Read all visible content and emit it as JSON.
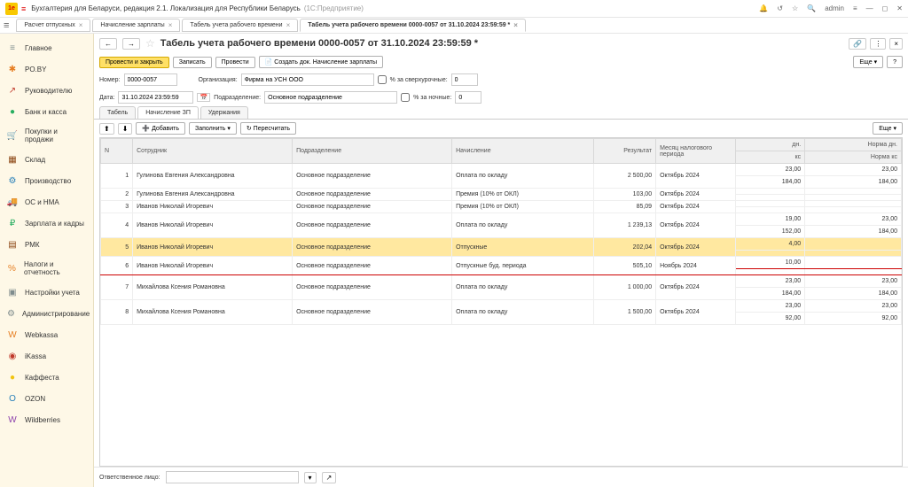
{
  "app": {
    "logo_text": "1e",
    "title": "Бухгалтерия для Беларуси, редакция 2.1. Локализация для Республики Беларусь",
    "subtitle": "(1С:Предприятие)",
    "user": "admin"
  },
  "tabs": [
    {
      "label": "Расчет отпускных"
    },
    {
      "label": "Начисление зарплаты"
    },
    {
      "label": "Табель учета рабочего времени"
    },
    {
      "label": "Табель учета рабочего времени 0000-0057 от 31.10.2024 23:59:59 *",
      "active": true
    }
  ],
  "sidebar": {
    "items": [
      {
        "label": "Главное",
        "icon": "≡",
        "cls": "c-gray"
      },
      {
        "label": "PO.BY",
        "icon": "✱",
        "cls": "c-orange"
      },
      {
        "label": "Руководителю",
        "icon": "↗",
        "cls": "c-red"
      },
      {
        "label": "Банк и касса",
        "icon": "●",
        "cls": "c-green"
      },
      {
        "label": "Покупки и продажи",
        "icon": "🛒",
        "cls": "c-brown"
      },
      {
        "label": "Склад",
        "icon": "▦",
        "cls": "c-brown"
      },
      {
        "label": "Производство",
        "icon": "⚙",
        "cls": "c-blue"
      },
      {
        "label": "ОС и НМА",
        "icon": "🚚",
        "cls": "c-brown"
      },
      {
        "label": "Зарплата и кадры",
        "icon": "₽",
        "cls": "c-green"
      },
      {
        "label": "РМК",
        "icon": "▤",
        "cls": "c-brown"
      },
      {
        "label": "Налоги и отчетность",
        "icon": "%",
        "cls": "c-orange"
      },
      {
        "label": "Настройки учета",
        "icon": "▣",
        "cls": "c-gray"
      },
      {
        "label": "Администрирование",
        "icon": "⚙",
        "cls": "c-gray"
      },
      {
        "label": "Webkassa",
        "icon": "W",
        "cls": "c-orange"
      },
      {
        "label": "iKassa",
        "icon": "◉",
        "cls": "c-red"
      },
      {
        "label": "Каффеста",
        "icon": "●",
        "cls": "c-yellow"
      },
      {
        "label": "OZON",
        "icon": "O",
        "cls": "c-blue"
      },
      {
        "label": "Wildberries",
        "icon": "W",
        "cls": "c-purple"
      }
    ]
  },
  "doc": {
    "title": "Табель учета рабочего времени 0000-0057 от 31.10.2024 23:59:59 *",
    "number_label": "Номер:",
    "number": "0000-0057",
    "org_label": "Организация:",
    "org": "Фирма на УСН ООО",
    "date_label": "Дата:",
    "date": "31.10.2024 23:59:59",
    "dept_label": "Подразделение:",
    "dept": "Основное подразделение",
    "overtime_label": "% за сверхурочные:",
    "overtime": "0",
    "night_label": "% за ночные:",
    "night": "0"
  },
  "toolbar": {
    "post_close": "Провести и закрыть",
    "save": "Записать",
    "post": "Провести",
    "create": "Создать док. Начисление зарплаты",
    "more": "Еще",
    "help": "?"
  },
  "subtabs": {
    "t1": "Табель",
    "t2": "Начисление ЗП",
    "t3": "Удержания"
  },
  "grid_toolbar": {
    "add": "Добавить",
    "fill": "Заполнить",
    "recalc": "Пересчитать",
    "more": "Еще"
  },
  "grid": {
    "headers": {
      "n": "N",
      "emp": "Сотрудник",
      "dept": "Подразделение",
      "accr": "Начисление",
      "res": "Результат",
      "period": "Месяц налогового периода",
      "dn": "дн.",
      "kc": "кс",
      "nd": "Норма дн.",
      "nk": "Норма кс"
    },
    "rows": [
      {
        "n": 1,
        "emp": "Гулинова Евгения Александровна",
        "dept": "Основное подразделение",
        "accr": "Оплата по окладу",
        "res": "2 500,00",
        "period": "Октябрь 2024",
        "dn": "23,00",
        "kc": "184,00",
        "nd": "23,00",
        "nk": "184,00"
      },
      {
        "n": 2,
        "emp": "Гулинова Евгения Александровна",
        "dept": "Основное подразделение",
        "accr": "Премия (10% от ОКЛ)",
        "res": "103,00",
        "period": "Октябрь 2024",
        "dn": "",
        "kc": "",
        "nd": "",
        "nk": ""
      },
      {
        "n": 3,
        "emp": "Иванов Николай Игоревич",
        "dept": "Основное подразделение",
        "accr": "Премия (10% от ОКЛ)",
        "res": "85,09",
        "period": "Октябрь 2024",
        "dn": "",
        "kc": "",
        "nd": "",
        "nk": ""
      },
      {
        "n": 4,
        "emp": "Иванов Николай Игоревич",
        "dept": "Основное подразделение",
        "accr": "Оплата по окладу",
        "res": "1 239,13",
        "period": "Октябрь 2024",
        "dn": "19,00",
        "kc": "152,00",
        "nd": "23,00",
        "nk": "184,00"
      },
      {
        "n": 5,
        "emp": "Иванов Николай Игоревич",
        "dept": "Основное подразделение",
        "accr": "Отпускные",
        "res": "202,04",
        "period": "Октябрь 2024",
        "dn": "4,00",
        "kc": "",
        "nd": "",
        "nk": "",
        "sel": true,
        "hlstart": true
      },
      {
        "n": 6,
        "emp": "Иванов Николай Игоревич",
        "dept": "Основное подразделение",
        "accr": "Отпускные буд. периода",
        "res": "505,10",
        "period": "Ноябрь 2024",
        "dn": "10,00",
        "kc": "",
        "nd": "",
        "nk": "",
        "hlend": true
      },
      {
        "n": 7,
        "emp": "Михайлова Ксения Романовна",
        "dept": "Основное подразделение",
        "accr": "Оплата по окладу",
        "res": "1 000,00",
        "period": "Октябрь 2024",
        "dn": "23,00",
        "kc": "184,00",
        "nd": "23,00",
        "nk": "184,00"
      },
      {
        "n": 8,
        "emp": "Михайлова Ксения Романовна",
        "dept": "Основное подразделение",
        "accr": "Оплата по окладу",
        "res": "1 500,00",
        "period": "Октябрь 2024",
        "dn": "23,00",
        "kc": "92,00",
        "nd": "23,00",
        "nk": "92,00"
      }
    ]
  },
  "footer": {
    "resp_label": "Ответственное лицо:",
    "resp": ""
  }
}
